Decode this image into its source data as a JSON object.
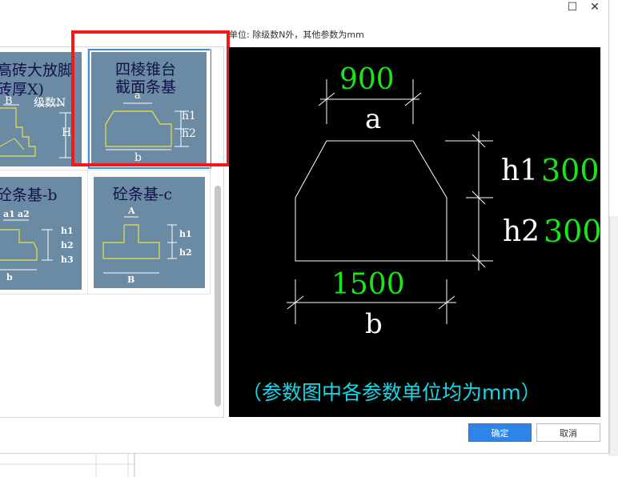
{
  "window": {
    "maximize_glyph": "☐",
    "close_glyph": "✕"
  },
  "unit_label": "单位:   除级数N外，其他参数为mm",
  "tiles": {
    "brick": {
      "title_line1": "高砖大放脚",
      "title_line2": "砖厚X)",
      "label_b": "B",
      "label_n": "级数N",
      "label_h": "H"
    },
    "frustum": {
      "title_line1": "四棱锥台",
      "title_line2": "截面条基",
      "label_a": "a",
      "label_h1": "h1",
      "label_h2": "h2",
      "label_b": "b"
    },
    "strip_b": {
      "title": "砼条基-b",
      "label_a1": "a1",
      "label_a2": "a2",
      "label_h1": "h1",
      "label_h2": "h2",
      "label_h3": "h3",
      "label_b": "b"
    },
    "strip_c": {
      "title": "砼条基-c",
      "label_a": "A",
      "label_h1": "h1",
      "label_h2": "h2",
      "label_b": "B"
    }
  },
  "preview": {
    "a_value": "900",
    "a_label": "a",
    "b_value": "1500",
    "b_label": "b",
    "h1_label": "h1",
    "h1_value": "300",
    "h2_label": "h2",
    "h2_value": "300",
    "note": "（参数图中各参数单位均为mm）"
  },
  "buttons": {
    "ok": "确定",
    "cancel": "取消"
  },
  "colors": {
    "tile_bg": "#6b8aa3",
    "shape_yellow": "#e6e24a",
    "value_green": "#19e619",
    "note_cyan": "#17d6e6",
    "selection_blue": "#3a8ee6",
    "highlight_red": "#f01818"
  }
}
